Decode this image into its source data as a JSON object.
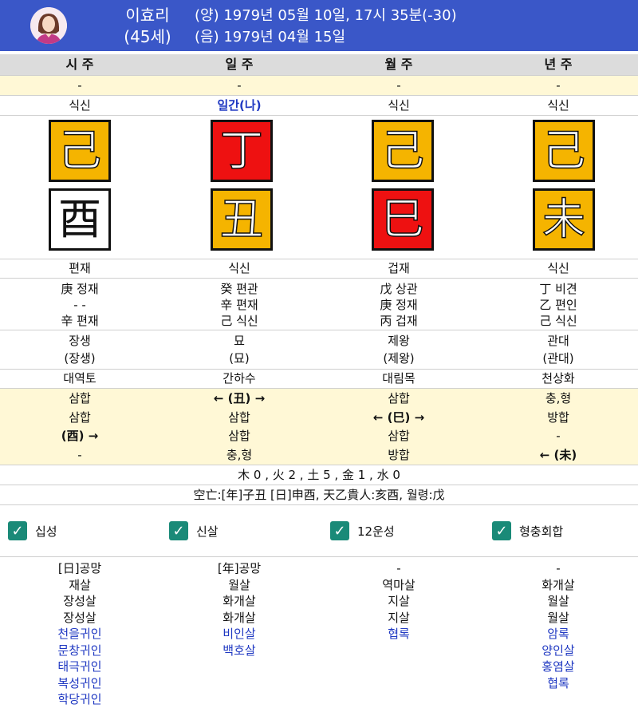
{
  "header": {
    "name": "이효리",
    "age": "(45세)",
    "solar": "(양) 1979년 05월 10일, 17시 35분(-30)",
    "lunar": "(음) 1979년 04월 15일",
    "colors": {
      "bg": "#3a57c8"
    }
  },
  "columns": [
    "시 주",
    "일 주",
    "월 주",
    "년 주"
  ],
  "dash_row": [
    "-",
    "-",
    "-",
    "-"
  ],
  "top_shishen": [
    "식신",
    "일간(나)",
    "식신",
    "식신"
  ],
  "stems": [
    {
      "char": "己",
      "bg": "#f5b400"
    },
    {
      "char": "丁",
      "bg": "#ee1111"
    },
    {
      "char": "己",
      "bg": "#f5b400"
    },
    {
      "char": "己",
      "bg": "#f5b400"
    }
  ],
  "branches": [
    {
      "char": "酉",
      "bg": "#ffffff"
    },
    {
      "char": "丑",
      "bg": "#f5b400"
    },
    {
      "char": "巳",
      "bg": "#ee1111"
    },
    {
      "char": "未",
      "bg": "#f5b400"
    }
  ],
  "bottom_shishen": [
    "편재",
    "식신",
    "겁재",
    "식신"
  ],
  "hidden": [
    [
      "庚 정재",
      "- -",
      "辛 편재"
    ],
    [
      "癸 편관",
      "辛 편재",
      "己 식신"
    ],
    [
      "戊 상관",
      "庚 정재",
      "丙 겁재"
    ],
    [
      "丁 비견",
      "乙 편인",
      "己 식신"
    ]
  ],
  "twelve": [
    [
      "장생",
      "(장생)"
    ],
    [
      "묘",
      "(묘)"
    ],
    [
      "제왕",
      "(제왕)"
    ],
    [
      "관대",
      "(관대)"
    ]
  ],
  "napeum": [
    "대역토",
    "간하수",
    "대림목",
    "천상화"
  ],
  "relations": [
    [
      "삼합",
      "삼합",
      "(酉) →",
      "-"
    ],
    [
      "← (丑) →",
      "삼합",
      "삼합",
      "충,형"
    ],
    [
      "삼합",
      "← (巳) →",
      "삼합",
      "방합"
    ],
    [
      "충,형",
      "방합",
      "-",
      "← (未)"
    ]
  ],
  "elements": "木 0 , 火 2 , 土 5 , 金 1 , 水 0",
  "gongmang": "空亡:[年]子丑 [日]申酉, 天乙貴人:亥酉, 월령:戊",
  "checkboxes": [
    "십성",
    "신살",
    "12운성",
    "형충회합"
  ],
  "sinsal": [
    {
      "black": [
        "[日]공망",
        "재살",
        "장성살",
        "장성살"
      ],
      "blue": [
        "천을귀인",
        "문창귀인",
        "태극귀인",
        "복성귀인",
        "학당귀인"
      ]
    },
    {
      "black": [
        "[年]공망",
        "월살",
        "화개살",
        "화개살"
      ],
      "blue": [
        "비인살",
        "백호살"
      ]
    },
    {
      "black": [
        "-",
        "역마살",
        "지살",
        "지살"
      ],
      "blue": [
        "협록"
      ]
    },
    {
      "black": [
        "-",
        "화개살",
        "월살",
        "월살"
      ],
      "blue": [
        "암록",
        "양인살",
        "홍염살",
        "협록"
      ]
    }
  ]
}
